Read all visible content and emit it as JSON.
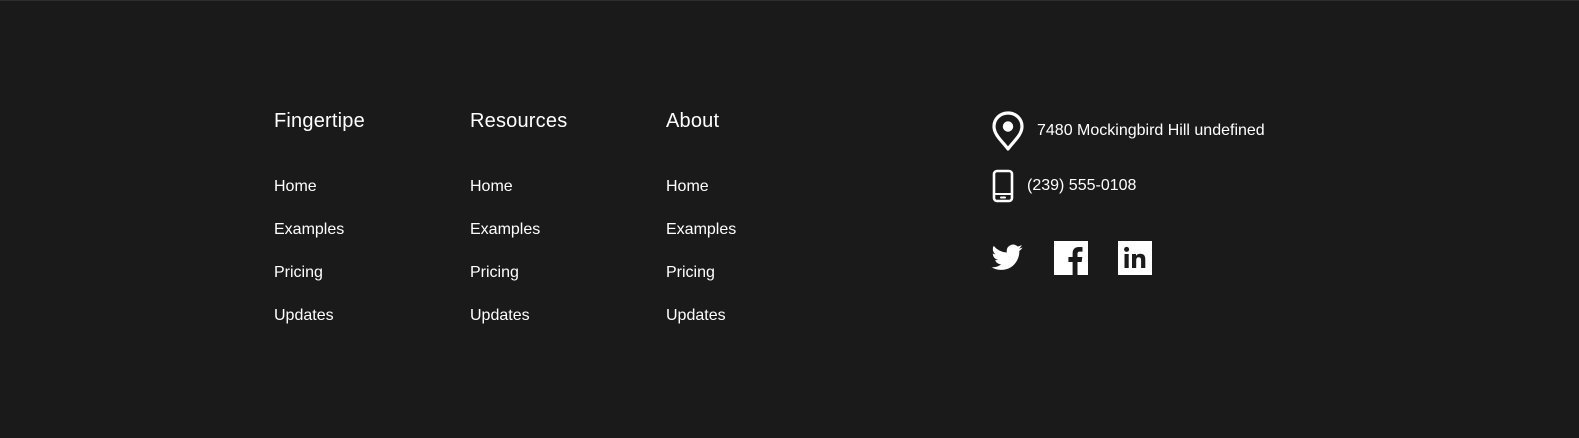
{
  "columns": [
    {
      "title": "Fingertipe",
      "links": [
        "Home",
        "Examples",
        "Pricing",
        "Updates"
      ]
    },
    {
      "title": "Resources",
      "links": [
        "Home",
        "Examples",
        "Pricing",
        "Updates"
      ]
    },
    {
      "title": "About",
      "links": [
        "Home",
        "Examples",
        "Pricing",
        "Updates"
      ]
    }
  ],
  "contact": {
    "address": "7480 Mockingbird Hill undefined",
    "address_icon": "location-pin-icon",
    "phone": "(239) 555-0108",
    "phone_icon": "mobile-phone-icon"
  },
  "social": [
    {
      "icon": "twitter-icon"
    },
    {
      "icon": "facebook-icon"
    },
    {
      "icon": "linkedin-icon"
    }
  ],
  "colors": {
    "background": "#1a1a1a",
    "text": "#ffffff"
  }
}
